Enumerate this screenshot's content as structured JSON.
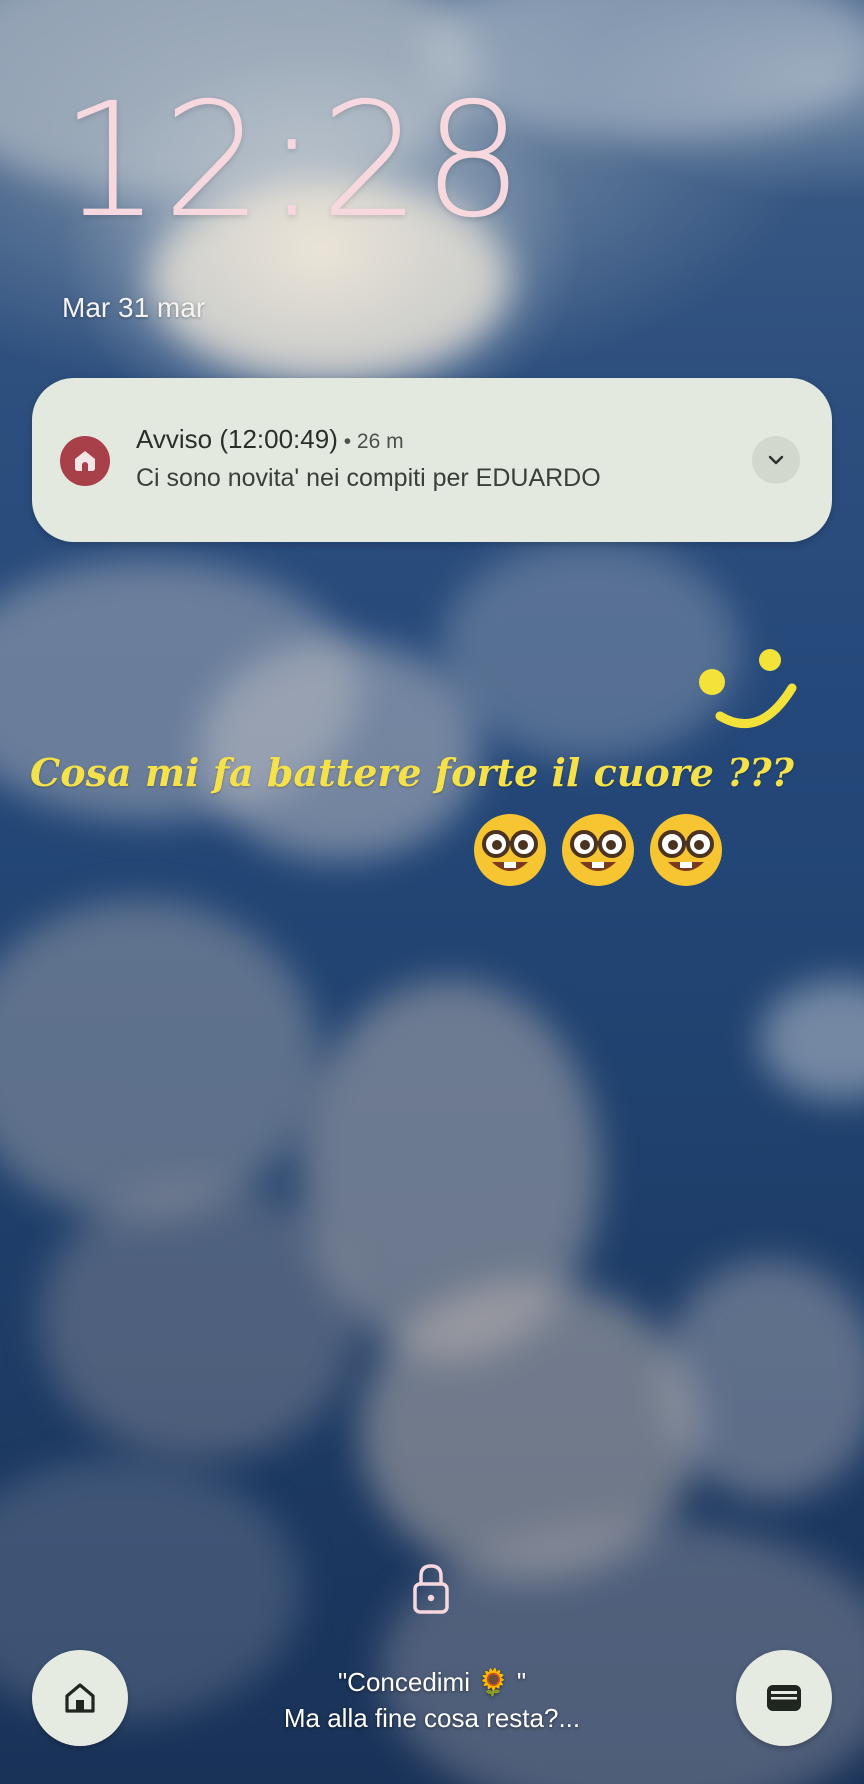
{
  "lockscreen": {
    "clock": "12:28",
    "date": "Mar 31 mar"
  },
  "notification": {
    "app_icon": "school-house-icon",
    "title": "Avviso (12:00:49)",
    "separator": " • ",
    "time_ago": "26 m",
    "body": "Ci sono novita' nei compiti per EDUARDO",
    "expand_icon": "chevron-down-icon"
  },
  "wallpaper_overlay": {
    "caption": "Cosa mi fa battere forte il cuore ???",
    "emoji_icon": "nerd-face-emoji",
    "emoji_count": 3,
    "smiley_icon": "smiley-doodle-icon"
  },
  "bottom": {
    "lock_icon": "lock-icon",
    "left_shortcut_icon": "home-icon",
    "right_shortcut_icon": "wallet-icon",
    "song_title": "\"Concedimi 🌻 \"",
    "song_subtitle": "Ma alla fine cosa resta?..."
  },
  "colors": {
    "clock": "#f6d8de",
    "notification_bg": "#e4e9df",
    "app_icon_bg": "#a8404a",
    "caption": "#f5e24a",
    "shortcut_bg": "#e6ebe1"
  }
}
